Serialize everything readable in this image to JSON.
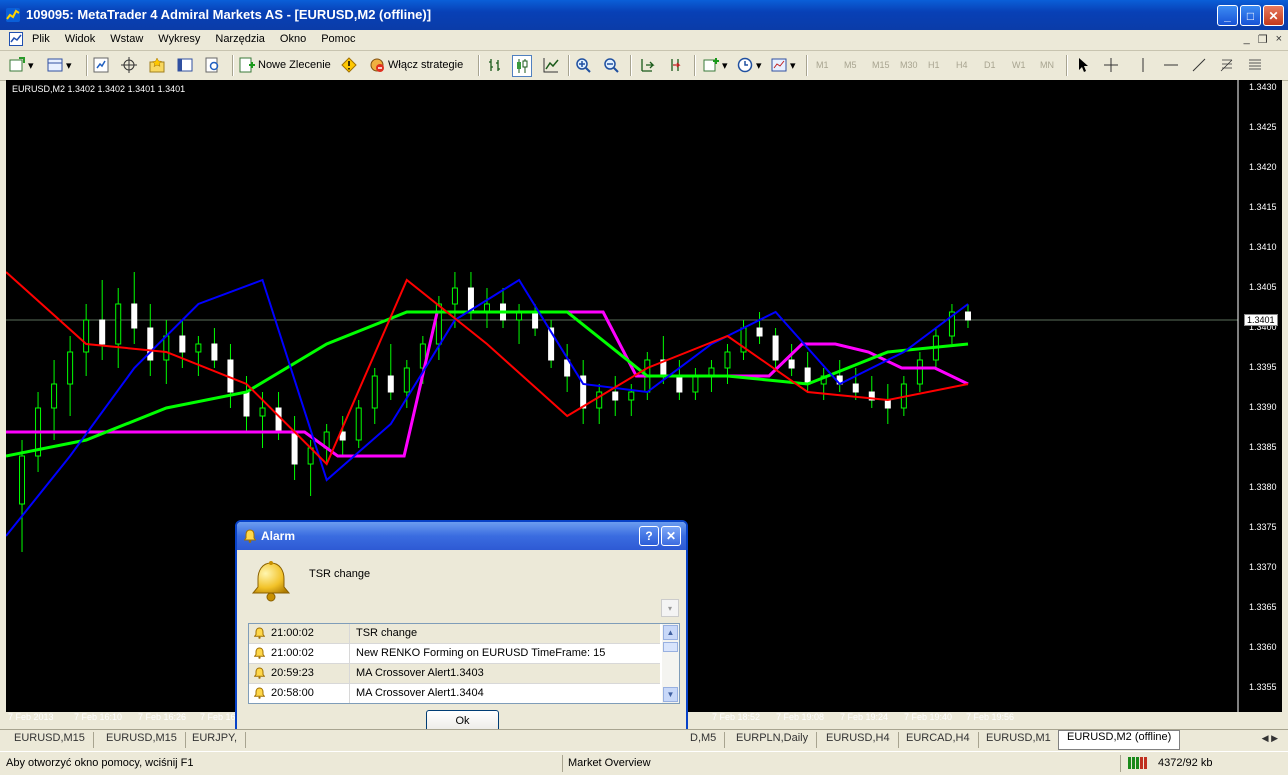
{
  "window": {
    "title": "109095: MetaTrader 4 Admiral Markets AS - [EURUSD,M2 (offline)]",
    "min": "_",
    "max": "□",
    "close": "✕"
  },
  "menu": {
    "items": [
      "Plik",
      "Widok",
      "Wstaw",
      "Wykresy",
      "Narzędzia",
      "Okno",
      "Pomoc"
    ],
    "mdi_min": "_",
    "mdi_restore": "❐",
    "mdi_close": "×"
  },
  "toolbar": {
    "new_order": "Nowe Zlecenie",
    "strategies": "Włącz strategie",
    "timeframes": [
      "M1",
      "M5",
      "M15",
      "M30",
      "H1",
      "H4",
      "D1",
      "W1",
      "MN"
    ]
  },
  "chart": {
    "info": "EURUSD,M2  1.3402 1.3402 1.3401 1.3401",
    "current_price": "1.3401",
    "price_labels": [
      "1.3430",
      "1.3425",
      "1.3420",
      "1.3415",
      "1.3410",
      "1.3405",
      "1.3400",
      "1.3395",
      "1.3390",
      "1.3385",
      "1.3380",
      "1.3375",
      "1.3370",
      "1.3365",
      "1.3360",
      "1.3355"
    ],
    "time_labels": [
      "7 Feb 2013",
      "7 Feb 16:10",
      "7 Feb 16:26",
      "7 Feb 16",
      "36",
      "7 Feb 18:52",
      "7 Feb 19:08",
      "7 Feb 19:24",
      "7 Feb 19:40",
      "7 Feb 19:56"
    ]
  },
  "chart_data": {
    "type": "candlestick",
    "symbol": "EURUSD",
    "timeframe": "M2",
    "ylim": [
      1.3352,
      1.3431
    ],
    "current_price": 1.3401,
    "candles": [
      [
        1.3378,
        1.3386,
        1.3372,
        1.3384
      ],
      [
        1.3384,
        1.3392,
        1.3382,
        1.339
      ],
      [
        1.339,
        1.3396,
        1.3386,
        1.3393
      ],
      [
        1.3393,
        1.3399,
        1.3389,
        1.3397
      ],
      [
        1.3397,
        1.3403,
        1.3394,
        1.3401
      ],
      [
        1.3401,
        1.3406,
        1.3396,
        1.3398
      ],
      [
        1.3398,
        1.3405,
        1.3395,
        1.3403
      ],
      [
        1.3403,
        1.3407,
        1.3398,
        1.34
      ],
      [
        1.34,
        1.3403,
        1.3394,
        1.3396
      ],
      [
        1.3396,
        1.3401,
        1.3393,
        1.3399
      ],
      [
        1.3399,
        1.3401,
        1.3395,
        1.3397
      ],
      [
        1.3397,
        1.3399,
        1.3394,
        1.3398
      ],
      [
        1.3398,
        1.34,
        1.3395,
        1.3396
      ],
      [
        1.3396,
        1.3398,
        1.339,
        1.3392
      ],
      [
        1.3392,
        1.3394,
        1.3387,
        1.3389
      ],
      [
        1.3389,
        1.3392,
        1.3385,
        1.339
      ],
      [
        1.339,
        1.3392,
        1.3386,
        1.3387
      ],
      [
        1.3387,
        1.3389,
        1.3381,
        1.3383
      ],
      [
        1.3383,
        1.3386,
        1.3379,
        1.3385
      ],
      [
        1.3385,
        1.3388,
        1.3383,
        1.3387
      ],
      [
        1.3387,
        1.3389,
        1.3384,
        1.3386
      ],
      [
        1.3386,
        1.3391,
        1.3385,
        1.339
      ],
      [
        1.339,
        1.3395,
        1.3388,
        1.3394
      ],
      [
        1.3394,
        1.3398,
        1.3391,
        1.3392
      ],
      [
        1.3392,
        1.3396,
        1.339,
        1.3395
      ],
      [
        1.3395,
        1.3399,
        1.3393,
        1.3398
      ],
      [
        1.3398,
        1.3404,
        1.3396,
        1.3403
      ],
      [
        1.3403,
        1.3407,
        1.34,
        1.3405
      ],
      [
        1.3405,
        1.3407,
        1.3401,
        1.3402
      ],
      [
        1.3402,
        1.3405,
        1.34,
        1.3403
      ],
      [
        1.3403,
        1.3405,
        1.34,
        1.3401
      ],
      [
        1.3401,
        1.3403,
        1.3398,
        1.3402
      ],
      [
        1.3402,
        1.3403,
        1.3399,
        1.34
      ],
      [
        1.34,
        1.3401,
        1.3395,
        1.3396
      ],
      [
        1.3396,
        1.3398,
        1.3392,
        1.3394
      ],
      [
        1.3394,
        1.3396,
        1.3388,
        1.339
      ],
      [
        1.339,
        1.3393,
        1.3388,
        1.3392
      ],
      [
        1.3392,
        1.3394,
        1.3389,
        1.3391
      ],
      [
        1.3391,
        1.3393,
        1.3389,
        1.3392
      ],
      [
        1.3392,
        1.3397,
        1.3391,
        1.3396
      ],
      [
        1.3396,
        1.3399,
        1.3393,
        1.3394
      ],
      [
        1.3394,
        1.3396,
        1.3391,
        1.3392
      ],
      [
        1.3392,
        1.3395,
        1.3391,
        1.3394
      ],
      [
        1.3394,
        1.3396,
        1.3392,
        1.3395
      ],
      [
        1.3395,
        1.3398,
        1.3393,
        1.3397
      ],
      [
        1.3397,
        1.3401,
        1.3396,
        1.34
      ],
      [
        1.34,
        1.3402,
        1.3398,
        1.3399
      ],
      [
        1.3399,
        1.34,
        1.3395,
        1.3396
      ],
      [
        1.3396,
        1.3398,
        1.3394,
        1.3395
      ],
      [
        1.3395,
        1.3397,
        1.3392,
        1.3393
      ],
      [
        1.3393,
        1.3395,
        1.3391,
        1.3394
      ],
      [
        1.3394,
        1.3396,
        1.3392,
        1.3393
      ],
      [
        1.3393,
        1.3395,
        1.3391,
        1.3392
      ],
      [
        1.3392,
        1.3394,
        1.339,
        1.3391
      ],
      [
        1.3391,
        1.3393,
        1.3388,
        1.339
      ],
      [
        1.339,
        1.3394,
        1.3389,
        1.3393
      ],
      [
        1.3393,
        1.3397,
        1.3392,
        1.3396
      ],
      [
        1.3396,
        1.34,
        1.3395,
        1.3399
      ],
      [
        1.3399,
        1.3403,
        1.3398,
        1.3402
      ],
      [
        1.3402,
        1.3403,
        1.34,
        1.3401
      ]
    ],
    "series": [
      {
        "name": "",
        "color": "#FF00FF",
        "values": [
          1.3387,
          1.3387,
          1.3387,
          1.3387,
          1.3387,
          1.3387,
          1.3387,
          1.3387,
          1.3387,
          1.3387,
          1.3384,
          1.3384,
          1.3384,
          1.3402,
          1.3402,
          1.3402,
          1.3402,
          1.3402,
          1.3402,
          1.3394,
          1.3394,
          1.3394,
          1.3394,
          1.3394,
          1.3398,
          1.3398,
          1.3397,
          1.3395,
          1.3395,
          1.3393
        ]
      },
      {
        "name": "",
        "color": "#00FF00",
        "values": [
          1.3384,
          1.3386,
          1.339,
          1.3392,
          1.3398,
          1.3402,
          1.3402,
          1.3402,
          1.3394,
          1.3394,
          1.3393,
          1.3397,
          1.3398
        ]
      },
      {
        "name": "",
        "color": "#0000FF",
        "values": [
          1.3374,
          1.3384,
          1.3395,
          1.3403,
          1.3406,
          1.3381,
          1.3388,
          1.3401,
          1.3406,
          1.3393,
          1.3392,
          1.3398,
          1.3402,
          1.3393,
          1.3397,
          1.3403
        ]
      },
      {
        "name": "",
        "color": "#FF0000",
        "values": [
          1.3407,
          1.3398,
          1.3397,
          1.3393,
          1.3383,
          1.3406,
          1.3398,
          1.3389,
          1.3395,
          1.3399,
          1.3392,
          1.3391,
          1.3393
        ]
      }
    ]
  },
  "dialog": {
    "title": "Alarm",
    "help": "?",
    "close": "✕",
    "message": "TSR change",
    "combo_arrow": "▾",
    "alarms": [
      {
        "time": "21:00:02",
        "text": "TSR change"
      },
      {
        "time": "21:00:02",
        "text": "New RENKO Forming on EURUSD TimeFrame: 15"
      },
      {
        "time": "20:59:23",
        "text": "MA Crossover Alert1.3403"
      },
      {
        "time": "20:58:00",
        "text": "MA Crossover Alert1.3404"
      }
    ],
    "scroll_up": "▲",
    "scroll_down": "▼",
    "ok": "Ok"
  },
  "tabs": {
    "items": [
      "EURUSD,M15",
      "EURUSD,M15",
      "EURJPY,",
      "D,M5",
      "EURPLN,Daily",
      "EURUSD,H4",
      "EURCAD,H4",
      "EURUSD,M1",
      "EURUSD,M2 (offline)"
    ],
    "arrows": "◀ ▶"
  },
  "status": {
    "help": "Aby otworzyć okno pomocy, wciśnij F1",
    "market": "Market Overview",
    "connection": "4372/92 kb"
  }
}
